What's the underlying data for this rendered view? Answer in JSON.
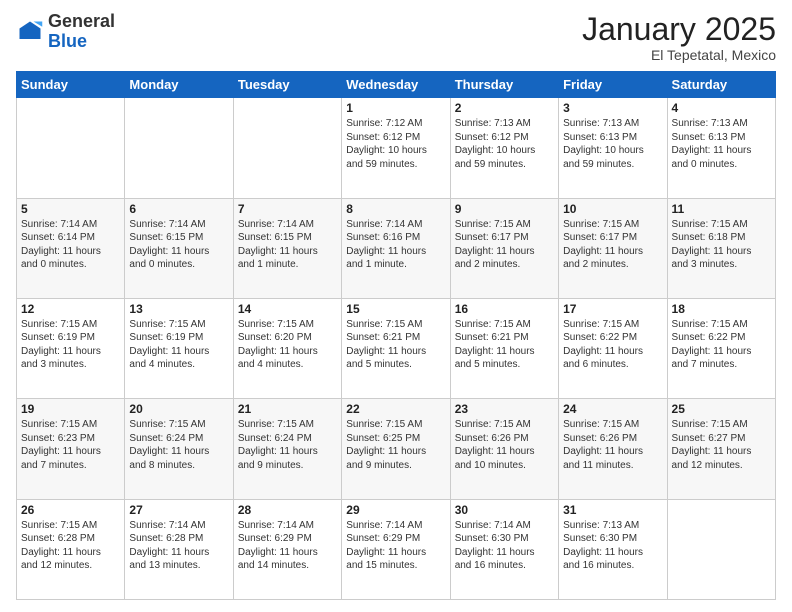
{
  "logo": {
    "general": "General",
    "blue": "Blue"
  },
  "header": {
    "month": "January 2025",
    "location": "El Tepetatal, Mexico"
  },
  "weekdays": [
    "Sunday",
    "Monday",
    "Tuesday",
    "Wednesday",
    "Thursday",
    "Friday",
    "Saturday"
  ],
  "weeks": [
    [
      {
        "day": "",
        "content": ""
      },
      {
        "day": "",
        "content": ""
      },
      {
        "day": "",
        "content": ""
      },
      {
        "day": "1",
        "content": "Sunrise: 7:12 AM\nSunset: 6:12 PM\nDaylight: 10 hours\nand 59 minutes."
      },
      {
        "day": "2",
        "content": "Sunrise: 7:13 AM\nSunset: 6:12 PM\nDaylight: 10 hours\nand 59 minutes."
      },
      {
        "day": "3",
        "content": "Sunrise: 7:13 AM\nSunset: 6:13 PM\nDaylight: 10 hours\nand 59 minutes."
      },
      {
        "day": "4",
        "content": "Sunrise: 7:13 AM\nSunset: 6:13 PM\nDaylight: 11 hours\nand 0 minutes."
      }
    ],
    [
      {
        "day": "5",
        "content": "Sunrise: 7:14 AM\nSunset: 6:14 PM\nDaylight: 11 hours\nand 0 minutes."
      },
      {
        "day": "6",
        "content": "Sunrise: 7:14 AM\nSunset: 6:15 PM\nDaylight: 11 hours\nand 0 minutes."
      },
      {
        "day": "7",
        "content": "Sunrise: 7:14 AM\nSunset: 6:15 PM\nDaylight: 11 hours\nand 1 minute."
      },
      {
        "day": "8",
        "content": "Sunrise: 7:14 AM\nSunset: 6:16 PM\nDaylight: 11 hours\nand 1 minute."
      },
      {
        "day": "9",
        "content": "Sunrise: 7:15 AM\nSunset: 6:17 PM\nDaylight: 11 hours\nand 2 minutes."
      },
      {
        "day": "10",
        "content": "Sunrise: 7:15 AM\nSunset: 6:17 PM\nDaylight: 11 hours\nand 2 minutes."
      },
      {
        "day": "11",
        "content": "Sunrise: 7:15 AM\nSunset: 6:18 PM\nDaylight: 11 hours\nand 3 minutes."
      }
    ],
    [
      {
        "day": "12",
        "content": "Sunrise: 7:15 AM\nSunset: 6:19 PM\nDaylight: 11 hours\nand 3 minutes."
      },
      {
        "day": "13",
        "content": "Sunrise: 7:15 AM\nSunset: 6:19 PM\nDaylight: 11 hours\nand 4 minutes."
      },
      {
        "day": "14",
        "content": "Sunrise: 7:15 AM\nSunset: 6:20 PM\nDaylight: 11 hours\nand 4 minutes."
      },
      {
        "day": "15",
        "content": "Sunrise: 7:15 AM\nSunset: 6:21 PM\nDaylight: 11 hours\nand 5 minutes."
      },
      {
        "day": "16",
        "content": "Sunrise: 7:15 AM\nSunset: 6:21 PM\nDaylight: 11 hours\nand 5 minutes."
      },
      {
        "day": "17",
        "content": "Sunrise: 7:15 AM\nSunset: 6:22 PM\nDaylight: 11 hours\nand 6 minutes."
      },
      {
        "day": "18",
        "content": "Sunrise: 7:15 AM\nSunset: 6:22 PM\nDaylight: 11 hours\nand 7 minutes."
      }
    ],
    [
      {
        "day": "19",
        "content": "Sunrise: 7:15 AM\nSunset: 6:23 PM\nDaylight: 11 hours\nand 7 minutes."
      },
      {
        "day": "20",
        "content": "Sunrise: 7:15 AM\nSunset: 6:24 PM\nDaylight: 11 hours\nand 8 minutes."
      },
      {
        "day": "21",
        "content": "Sunrise: 7:15 AM\nSunset: 6:24 PM\nDaylight: 11 hours\nand 9 minutes."
      },
      {
        "day": "22",
        "content": "Sunrise: 7:15 AM\nSunset: 6:25 PM\nDaylight: 11 hours\nand 9 minutes."
      },
      {
        "day": "23",
        "content": "Sunrise: 7:15 AM\nSunset: 6:26 PM\nDaylight: 11 hours\nand 10 minutes."
      },
      {
        "day": "24",
        "content": "Sunrise: 7:15 AM\nSunset: 6:26 PM\nDaylight: 11 hours\nand 11 minutes."
      },
      {
        "day": "25",
        "content": "Sunrise: 7:15 AM\nSunset: 6:27 PM\nDaylight: 11 hours\nand 12 minutes."
      }
    ],
    [
      {
        "day": "26",
        "content": "Sunrise: 7:15 AM\nSunset: 6:28 PM\nDaylight: 11 hours\nand 12 minutes."
      },
      {
        "day": "27",
        "content": "Sunrise: 7:14 AM\nSunset: 6:28 PM\nDaylight: 11 hours\nand 13 minutes."
      },
      {
        "day": "28",
        "content": "Sunrise: 7:14 AM\nSunset: 6:29 PM\nDaylight: 11 hours\nand 14 minutes."
      },
      {
        "day": "29",
        "content": "Sunrise: 7:14 AM\nSunset: 6:29 PM\nDaylight: 11 hours\nand 15 minutes."
      },
      {
        "day": "30",
        "content": "Sunrise: 7:14 AM\nSunset: 6:30 PM\nDaylight: 11 hours\nand 16 minutes."
      },
      {
        "day": "31",
        "content": "Sunrise: 7:13 AM\nSunset: 6:30 PM\nDaylight: 11 hours\nand 16 minutes."
      },
      {
        "day": "",
        "content": ""
      }
    ]
  ]
}
